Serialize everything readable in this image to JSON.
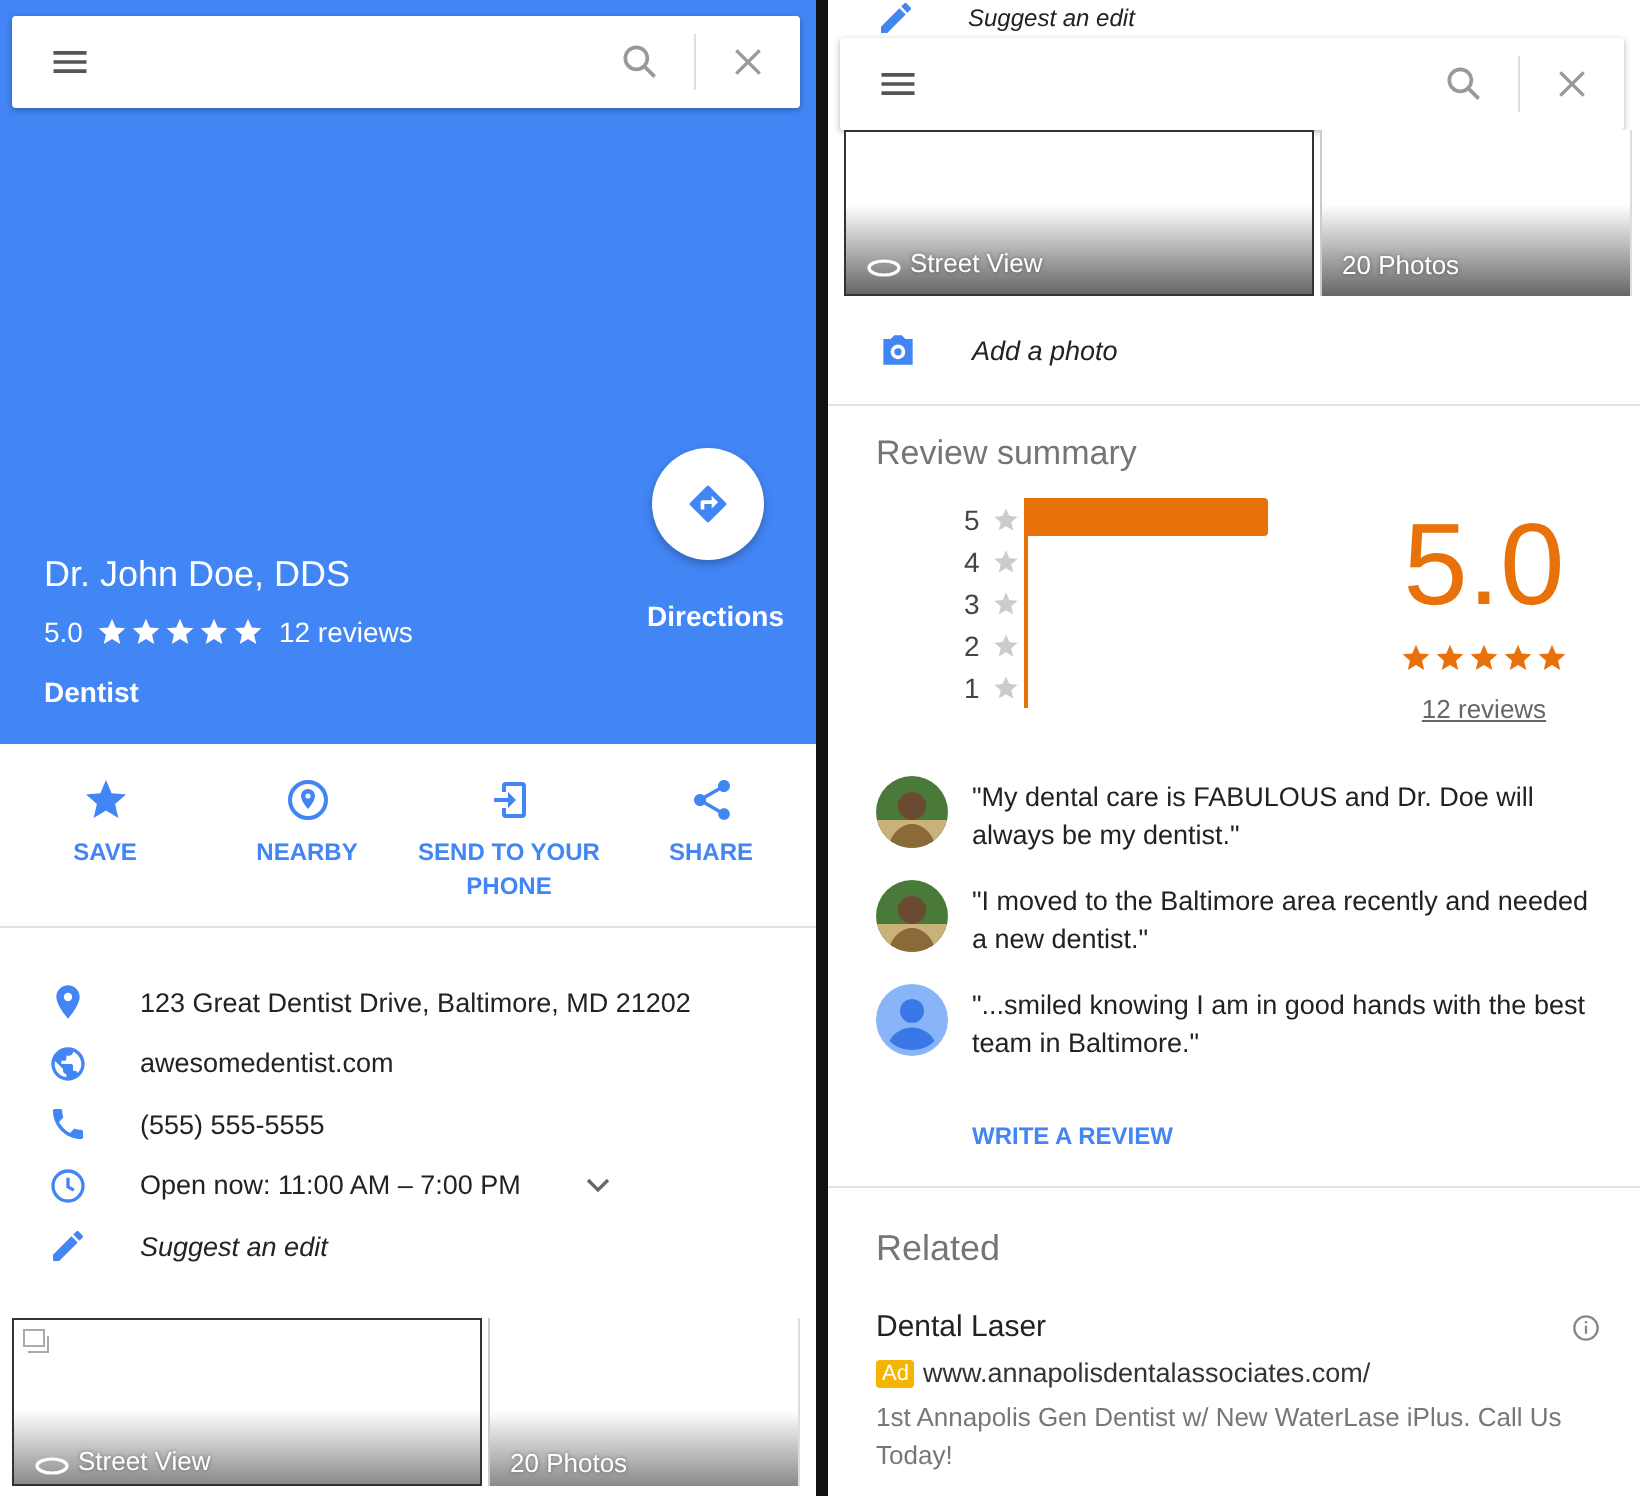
{
  "left": {
    "place": {
      "name": "Dr. John Doe, DDS",
      "rating": "5.0",
      "stars": 5,
      "reviews": "12 reviews",
      "category": "Dentist",
      "directions": "Directions"
    },
    "actions": [
      {
        "kind": "save",
        "label": "SAVE"
      },
      {
        "kind": "nearby",
        "label": "NEARBY"
      },
      {
        "kind": "send",
        "label": "SEND TO YOUR PHONE"
      },
      {
        "kind": "share",
        "label": "SHARE"
      }
    ],
    "info": [
      {
        "kind": "address",
        "text": "123 Great Dentist Drive, Baltimore, MD 21202"
      },
      {
        "kind": "website",
        "text": "awesomedentist.com"
      },
      {
        "kind": "phone",
        "text": "(555) 555-5555"
      },
      {
        "kind": "hours",
        "text": "Open now:  11:00 AM – 7:00 PM"
      },
      {
        "kind": "edit",
        "text": "Suggest an edit"
      }
    ],
    "tiles": [
      {
        "kind": "street_view",
        "label": "Street View"
      },
      {
        "kind": "photos",
        "label": "20 Photos"
      }
    ]
  },
  "right": {
    "top_row": {
      "kind": "edit",
      "text": "Suggest an edit"
    },
    "tiles": [
      {
        "kind": "street_view",
        "label": "Street View"
      },
      {
        "kind": "photos",
        "label": "20 Photos"
      }
    ],
    "add_photo": "Add a photo",
    "review_summary": {
      "title": "Review summary",
      "histogram": [
        {
          "label": "5",
          "level": 1
        },
        {
          "label": "4",
          "level": 0
        },
        {
          "label": "3",
          "level": 0
        },
        {
          "label": "2",
          "level": 0
        },
        {
          "label": "1",
          "level": 0
        }
      ],
      "rating": "5.0",
      "stars": 5,
      "reviews": "12 reviews"
    },
    "reviews": [
      {
        "text": "\"My dental care is FABULOUS and Dr. Doe will always be my dentist.\""
      },
      {
        "text": "\"I moved to the Baltimore area recently and needed a new dentist.\""
      },
      {
        "kind": "default",
        "text": "\"...smiled knowing I am in good hands with the best team in Baltimore.\""
      }
    ],
    "write_review": "WRITE A REVIEW",
    "related": {
      "title": "Related",
      "ad": {
        "title": "Dental Laser",
        "badge": "Ad",
        "url": "www.annapolisdentalassociates.com/",
        "description": "1st Annapolis Gen Dentist w/ New WaterLase iPlus. Call Us Today!"
      }
    }
  }
}
